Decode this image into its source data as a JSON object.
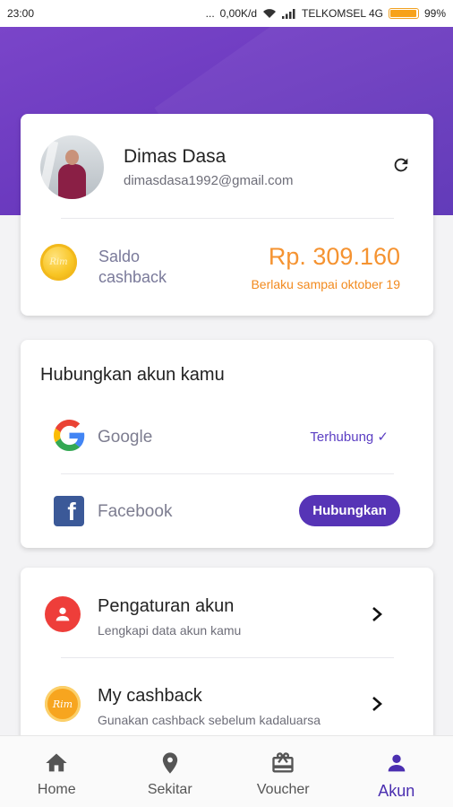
{
  "status_bar": {
    "time": "23:00",
    "dots": "...",
    "speed": "0,00K/d",
    "carrier": "TELKOMSEL 4G",
    "battery": "99%",
    "battery_level": 0.99
  },
  "profile": {
    "name": "Dimas Dasa",
    "email": "dimasdasa1992@gmail.com",
    "refresh_icon": "refresh-icon",
    "cashback_label": "Saldo\ncashback",
    "cashback_amount": "Rp. 309.160",
    "cashback_validity": "Berlaku sampai oktober 19",
    "coin_text": "Rim",
    "accent_color": "#f59331"
  },
  "link_accounts": {
    "title": "Hubungkan akun kamu",
    "providers": [
      {
        "name": "Google",
        "status": "Terhubung ✓",
        "icon": "google-icon"
      },
      {
        "name": "Facebook",
        "button": "Hubungkan",
        "icon": "facebook-icon"
      }
    ]
  },
  "menu": {
    "items": [
      {
        "title": "Pengaturan akun",
        "subtitle": "Lengkapi data akun kamu",
        "icon": "user-icon",
        "color": "#ee3e3a"
      },
      {
        "title": "My cashback",
        "subtitle": "Gunakan cashback sebelum kadaluarsa",
        "icon": "cashback-icon",
        "color": "#f7a51f",
        "icon_text": "Rim"
      }
    ]
  },
  "bottom_nav": {
    "items": [
      {
        "label": "Home",
        "icon": "home-icon"
      },
      {
        "label": "Sekitar",
        "icon": "location-pin-icon"
      },
      {
        "label": "Voucher",
        "icon": "gift-icon"
      },
      {
        "label": "Akun",
        "icon": "person-icon",
        "active": true
      }
    ]
  },
  "colors": {
    "brand_purple": "#6a39be",
    "button_purple": "#5634b6",
    "active_nav": "#4b2fb0"
  }
}
